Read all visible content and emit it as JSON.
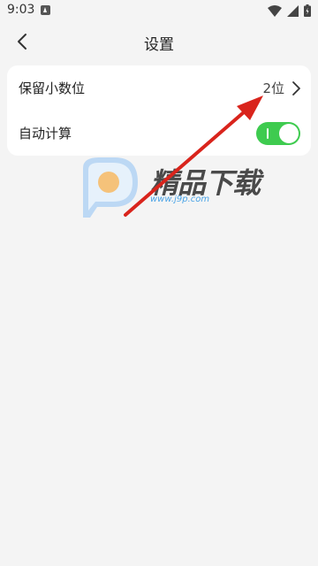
{
  "status_bar": {
    "time": "9:03",
    "icons": [
      "notification-icon",
      "wifi-icon",
      "signal-icon",
      "battery-icon"
    ]
  },
  "header": {
    "title": "设置",
    "back_icon": "back-arrow-icon"
  },
  "settings": {
    "items": [
      {
        "label": "保留小数位",
        "value": "2位",
        "type": "link"
      },
      {
        "label": "自动计算",
        "type": "toggle",
        "enabled": true
      }
    ]
  },
  "watermark": {
    "title": "精品下载",
    "url": "www.j9p.com"
  },
  "colors": {
    "background": "#f4f4f4",
    "card": "#ffffff",
    "toggle_on": "#3ecb4f",
    "annotation_arrow": "#d9241c",
    "watermark_blue": "#4aa3e6"
  }
}
